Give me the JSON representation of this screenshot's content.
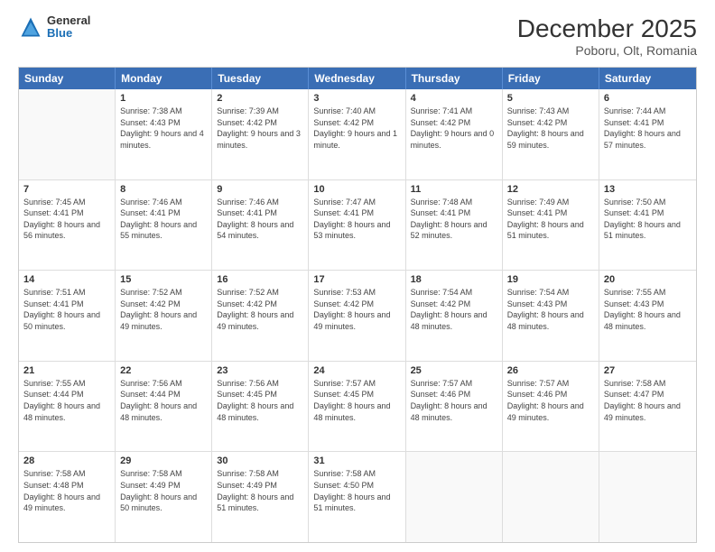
{
  "header": {
    "logo_general": "General",
    "logo_blue": "Blue",
    "title": "December 2025",
    "subtitle": "Poboru, Olt, Romania"
  },
  "days_of_week": [
    "Sunday",
    "Monday",
    "Tuesday",
    "Wednesday",
    "Thursday",
    "Friday",
    "Saturday"
  ],
  "weeks": [
    [
      {
        "day": "",
        "sunrise": "",
        "sunset": "",
        "daylight": ""
      },
      {
        "day": "1",
        "sunrise": "Sunrise: 7:38 AM",
        "sunset": "Sunset: 4:43 PM",
        "daylight": "Daylight: 9 hours and 4 minutes."
      },
      {
        "day": "2",
        "sunrise": "Sunrise: 7:39 AM",
        "sunset": "Sunset: 4:42 PM",
        "daylight": "Daylight: 9 hours and 3 minutes."
      },
      {
        "day": "3",
        "sunrise": "Sunrise: 7:40 AM",
        "sunset": "Sunset: 4:42 PM",
        "daylight": "Daylight: 9 hours and 1 minute."
      },
      {
        "day": "4",
        "sunrise": "Sunrise: 7:41 AM",
        "sunset": "Sunset: 4:42 PM",
        "daylight": "Daylight: 9 hours and 0 minutes."
      },
      {
        "day": "5",
        "sunrise": "Sunrise: 7:43 AM",
        "sunset": "Sunset: 4:42 PM",
        "daylight": "Daylight: 8 hours and 59 minutes."
      },
      {
        "day": "6",
        "sunrise": "Sunrise: 7:44 AM",
        "sunset": "Sunset: 4:41 PM",
        "daylight": "Daylight: 8 hours and 57 minutes."
      }
    ],
    [
      {
        "day": "7",
        "sunrise": "Sunrise: 7:45 AM",
        "sunset": "Sunset: 4:41 PM",
        "daylight": "Daylight: 8 hours and 56 minutes."
      },
      {
        "day": "8",
        "sunrise": "Sunrise: 7:46 AM",
        "sunset": "Sunset: 4:41 PM",
        "daylight": "Daylight: 8 hours and 55 minutes."
      },
      {
        "day": "9",
        "sunrise": "Sunrise: 7:46 AM",
        "sunset": "Sunset: 4:41 PM",
        "daylight": "Daylight: 8 hours and 54 minutes."
      },
      {
        "day": "10",
        "sunrise": "Sunrise: 7:47 AM",
        "sunset": "Sunset: 4:41 PM",
        "daylight": "Daylight: 8 hours and 53 minutes."
      },
      {
        "day": "11",
        "sunrise": "Sunrise: 7:48 AM",
        "sunset": "Sunset: 4:41 PM",
        "daylight": "Daylight: 8 hours and 52 minutes."
      },
      {
        "day": "12",
        "sunrise": "Sunrise: 7:49 AM",
        "sunset": "Sunset: 4:41 PM",
        "daylight": "Daylight: 8 hours and 51 minutes."
      },
      {
        "day": "13",
        "sunrise": "Sunrise: 7:50 AM",
        "sunset": "Sunset: 4:41 PM",
        "daylight": "Daylight: 8 hours and 51 minutes."
      }
    ],
    [
      {
        "day": "14",
        "sunrise": "Sunrise: 7:51 AM",
        "sunset": "Sunset: 4:41 PM",
        "daylight": "Daylight: 8 hours and 50 minutes."
      },
      {
        "day": "15",
        "sunrise": "Sunrise: 7:52 AM",
        "sunset": "Sunset: 4:42 PM",
        "daylight": "Daylight: 8 hours and 49 minutes."
      },
      {
        "day": "16",
        "sunrise": "Sunrise: 7:52 AM",
        "sunset": "Sunset: 4:42 PM",
        "daylight": "Daylight: 8 hours and 49 minutes."
      },
      {
        "day": "17",
        "sunrise": "Sunrise: 7:53 AM",
        "sunset": "Sunset: 4:42 PM",
        "daylight": "Daylight: 8 hours and 49 minutes."
      },
      {
        "day": "18",
        "sunrise": "Sunrise: 7:54 AM",
        "sunset": "Sunset: 4:42 PM",
        "daylight": "Daylight: 8 hours and 48 minutes."
      },
      {
        "day": "19",
        "sunrise": "Sunrise: 7:54 AM",
        "sunset": "Sunset: 4:43 PM",
        "daylight": "Daylight: 8 hours and 48 minutes."
      },
      {
        "day": "20",
        "sunrise": "Sunrise: 7:55 AM",
        "sunset": "Sunset: 4:43 PM",
        "daylight": "Daylight: 8 hours and 48 minutes."
      }
    ],
    [
      {
        "day": "21",
        "sunrise": "Sunrise: 7:55 AM",
        "sunset": "Sunset: 4:44 PM",
        "daylight": "Daylight: 8 hours and 48 minutes."
      },
      {
        "day": "22",
        "sunrise": "Sunrise: 7:56 AM",
        "sunset": "Sunset: 4:44 PM",
        "daylight": "Daylight: 8 hours and 48 minutes."
      },
      {
        "day": "23",
        "sunrise": "Sunrise: 7:56 AM",
        "sunset": "Sunset: 4:45 PM",
        "daylight": "Daylight: 8 hours and 48 minutes."
      },
      {
        "day": "24",
        "sunrise": "Sunrise: 7:57 AM",
        "sunset": "Sunset: 4:45 PM",
        "daylight": "Daylight: 8 hours and 48 minutes."
      },
      {
        "day": "25",
        "sunrise": "Sunrise: 7:57 AM",
        "sunset": "Sunset: 4:46 PM",
        "daylight": "Daylight: 8 hours and 48 minutes."
      },
      {
        "day": "26",
        "sunrise": "Sunrise: 7:57 AM",
        "sunset": "Sunset: 4:46 PM",
        "daylight": "Daylight: 8 hours and 49 minutes."
      },
      {
        "day": "27",
        "sunrise": "Sunrise: 7:58 AM",
        "sunset": "Sunset: 4:47 PM",
        "daylight": "Daylight: 8 hours and 49 minutes."
      }
    ],
    [
      {
        "day": "28",
        "sunrise": "Sunrise: 7:58 AM",
        "sunset": "Sunset: 4:48 PM",
        "daylight": "Daylight: 8 hours and 49 minutes."
      },
      {
        "day": "29",
        "sunrise": "Sunrise: 7:58 AM",
        "sunset": "Sunset: 4:49 PM",
        "daylight": "Daylight: 8 hours and 50 minutes."
      },
      {
        "day": "30",
        "sunrise": "Sunrise: 7:58 AM",
        "sunset": "Sunset: 4:49 PM",
        "daylight": "Daylight: 8 hours and 51 minutes."
      },
      {
        "day": "31",
        "sunrise": "Sunrise: 7:58 AM",
        "sunset": "Sunset: 4:50 PM",
        "daylight": "Daylight: 8 hours and 51 minutes."
      },
      {
        "day": "",
        "sunrise": "",
        "sunset": "",
        "daylight": ""
      },
      {
        "day": "",
        "sunrise": "",
        "sunset": "",
        "daylight": ""
      },
      {
        "day": "",
        "sunrise": "",
        "sunset": "",
        "daylight": ""
      }
    ]
  ]
}
